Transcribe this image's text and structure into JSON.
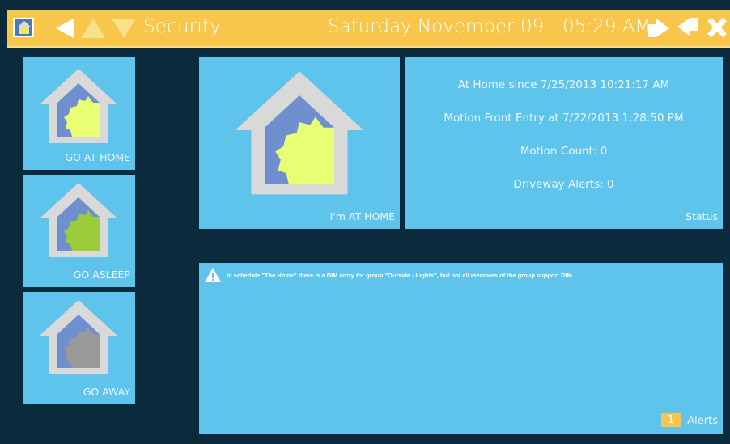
{
  "header": {
    "title": "Security",
    "datetime": "Saturday November 09 - 05:29 AM"
  },
  "colors": {
    "background": "#0b2a3c",
    "topbar": "#f8c64a",
    "tile": "#5fc4ec",
    "house_roof": "#d9d9d9",
    "house_body": "#6f8fcf",
    "gear_home": "#e9ff73",
    "gear_asleep": "#9ccc3a",
    "gear_away": "#9a9a9a"
  },
  "modes": [
    {
      "label": "GO AT HOME",
      "gear_color": "#e9ff73"
    },
    {
      "label": "GO ASLEEP",
      "gear_color": "#9ccc3a"
    },
    {
      "label": "GO AWAY",
      "gear_color": "#9a9a9a"
    }
  ],
  "current_mode": {
    "label": "I'm AT HOME"
  },
  "status": {
    "lines": [
      "At Home since 7/25/2013 10:21:17 AM",
      "Motion Front Entry at 7/22/2013 1:28:50 PM",
      "Motion Count: 0",
      "Driveway Alerts: 0"
    ],
    "label": "Status"
  },
  "alerts": {
    "message": "In schedule \"The Home\" there is a DIM entry for group \"Outside - Lights\", but not all members of the group support DIM.",
    "count": "1",
    "label": "Alerts"
  }
}
